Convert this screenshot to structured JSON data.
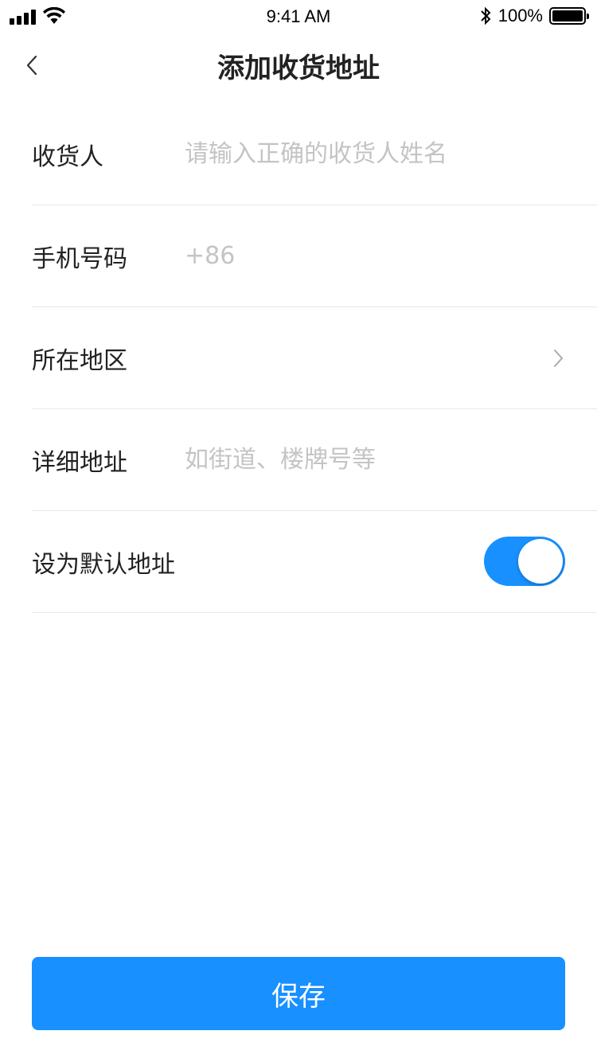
{
  "status_bar": {
    "time": "9:41 AM",
    "battery_percent": "100%",
    "icons": [
      "signal-icon",
      "wifi-icon",
      "bluetooth-icon",
      "battery-icon"
    ]
  },
  "nav": {
    "title": "添加收货地址",
    "back_icon": "chevron-left-icon"
  },
  "form": {
    "recipient": {
      "label": "收货人",
      "placeholder": "请输入正确的收货人姓名",
      "value": ""
    },
    "phone": {
      "label": "手机号码",
      "prefix": "+86",
      "value": ""
    },
    "region": {
      "label": "所在地区",
      "value": "",
      "icon": "chevron-right-icon"
    },
    "detail": {
      "label": "详细地址",
      "placeholder": "如街道、楼牌号等",
      "value": ""
    },
    "default": {
      "label": "设为默认地址",
      "enabled": true
    }
  },
  "save_button": {
    "label": "保存"
  },
  "colors": {
    "accent": "#1890ff",
    "placeholder": "#c4c4c4",
    "divider": "#e8e8e8",
    "text": "#222222"
  }
}
